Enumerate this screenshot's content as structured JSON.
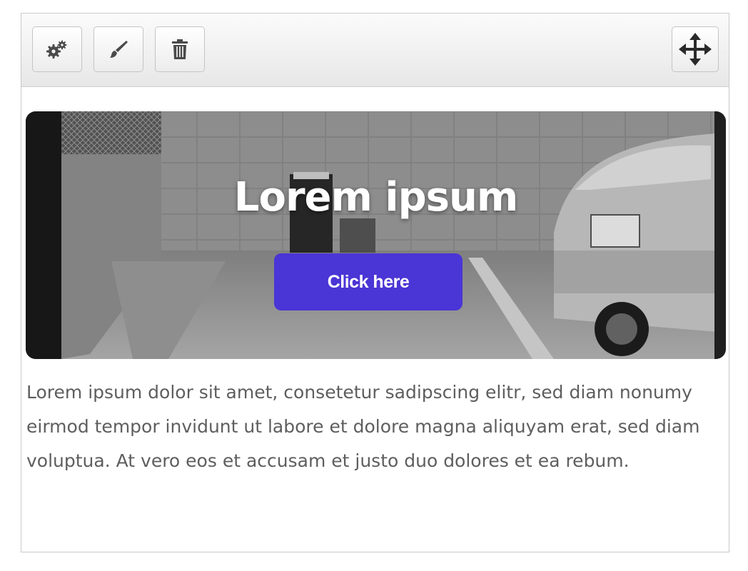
{
  "toolbar": {
    "buttons": [
      {
        "icon": "gears-icon",
        "name": "settings"
      },
      {
        "icon": "paintbrush-icon",
        "name": "style"
      },
      {
        "icon": "trash-icon",
        "name": "delete"
      }
    ],
    "move_icon": "move-arrows-icon"
  },
  "hero": {
    "title": "Lorem ipsum",
    "cta_label": "Click here",
    "cta_color": "#4a35d6"
  },
  "content": {
    "paragraph": "Lorem ipsum dolor sit amet, consetetur sadipscing elitr, sed diam nonumy eirmod tempor invidunt ut labore et dolore magna aliquyam erat, sed diam voluptua. At vero eos et accusam et justo duo dolores et ea rebum."
  }
}
